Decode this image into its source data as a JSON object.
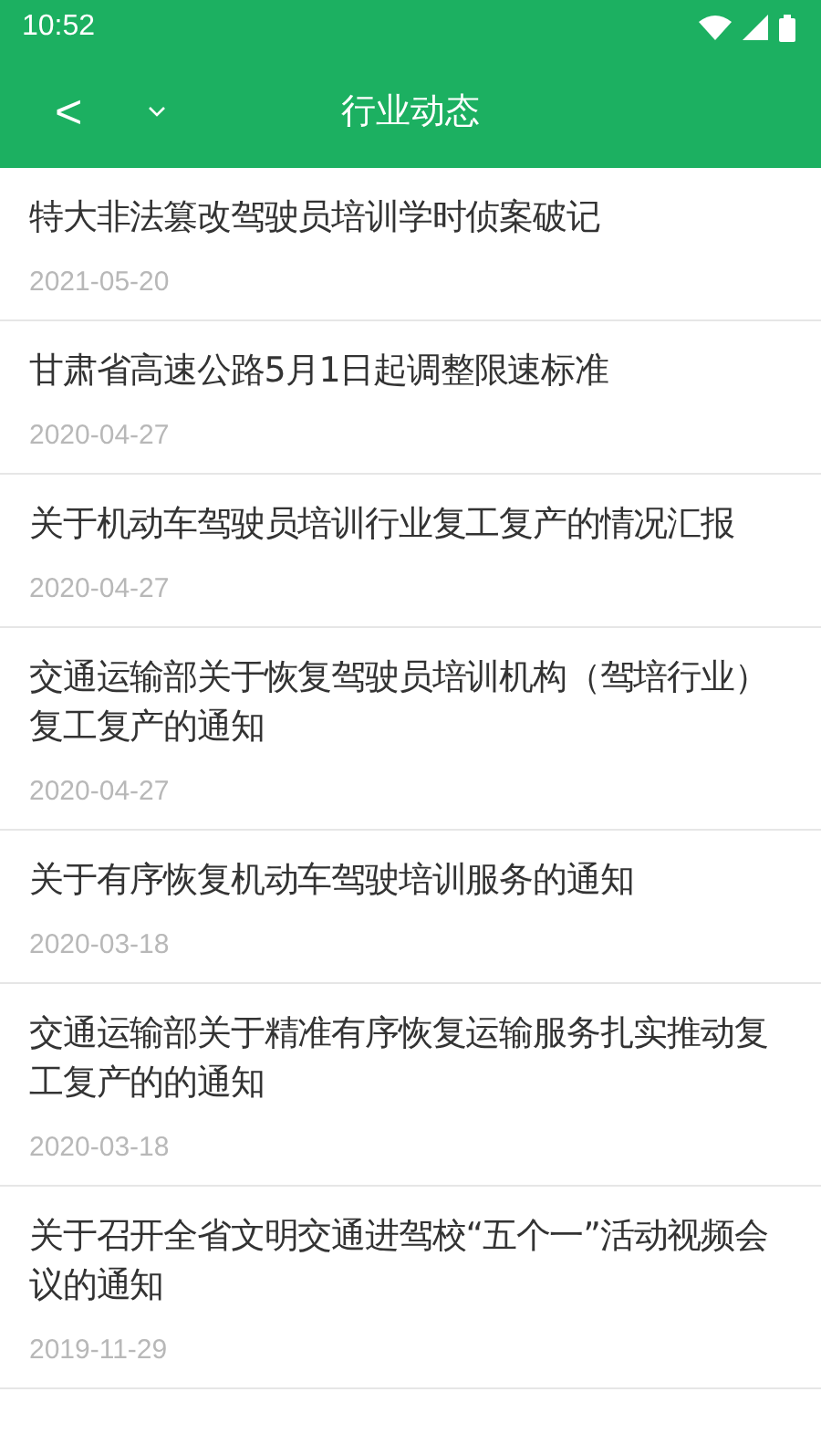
{
  "status_bar": {
    "time": "10:52"
  },
  "header": {
    "back": "<",
    "title": "行业动态"
  },
  "articles": [
    {
      "title": "特大非法篡改驾驶员培训学时侦案破记",
      "date": "2021-05-20"
    },
    {
      "title": "甘肃省高速公路5月1日起调整限速标准",
      "date": "2020-04-27"
    },
    {
      "title": "关于机动车驾驶员培训行业复工复产的情况汇报",
      "date": "2020-04-27"
    },
    {
      "title": "交通运输部关于恢复驾驶员培训机构（驾培行业）复工复产的通知",
      "date": "2020-04-27"
    },
    {
      "title": "关于有序恢复机动车驾驶培训服务的通知",
      "date": "2020-03-18"
    },
    {
      "title": "交通运输部关于精准有序恢复运输服务扎实推动复工复产的的通知",
      "date": "2020-03-18"
    },
    {
      "title": "关于召开全省文明交通进驾校“五个一”活动视频会议的通知",
      "date": "2019-11-29"
    }
  ]
}
